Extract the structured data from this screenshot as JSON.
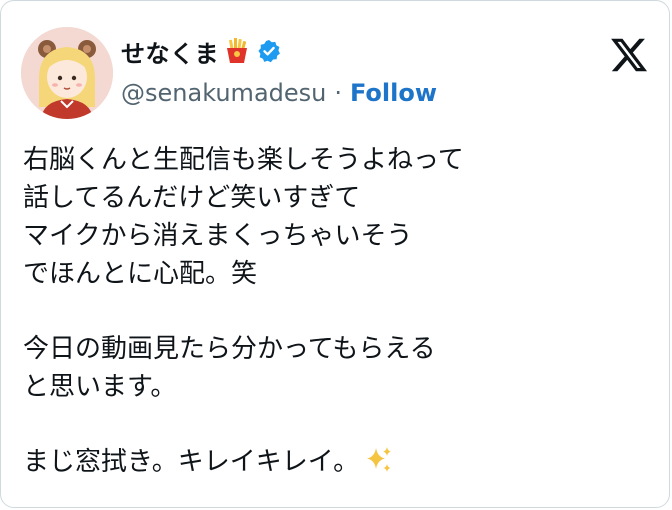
{
  "author": {
    "display_name": "せなくま",
    "handle": "@senakumadesu",
    "separator": "·",
    "follow_label": "Follow",
    "name_emoji": "fries-emoji",
    "verified": true,
    "verified_color": "#1d9bf0"
  },
  "tweet": {
    "paragraphs": [
      [
        "右脳くんと生配信も楽しそうよねって",
        "話してるんだけど笑いすぎて",
        "マイクから消えまくっちゃいそう",
        "でほんとに心配。笑"
      ],
      [
        "今日の動画見たら分かってもらえる",
        "と思います。"
      ],
      [
        "まじ窓拭き。キレイキレイ。"
      ]
    ],
    "trailing_emoji": "sparkles-emoji"
  },
  "colors": {
    "follow": "#1d74c9",
    "handle": "#536471",
    "border": "#cfd9de"
  },
  "icons": {
    "brand": "x-logo-icon"
  }
}
